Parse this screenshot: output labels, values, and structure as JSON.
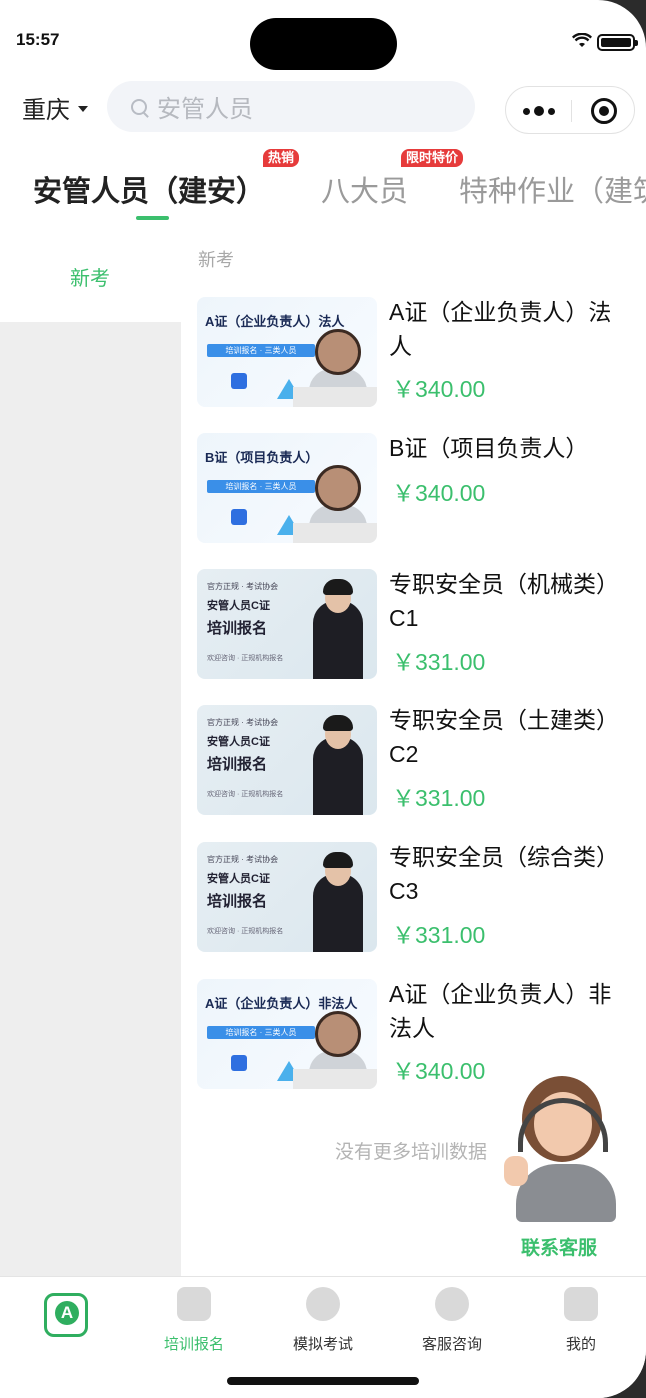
{
  "status": {
    "time": "15:57"
  },
  "header": {
    "city": "重庆",
    "search_placeholder": "安管人员"
  },
  "tabs": [
    {
      "label": "安管人员（建安）",
      "badge": ""
    },
    {
      "label": "八大员",
      "badge": "热销"
    },
    {
      "label": "特种作业（建筑",
      "badge": "限时特价"
    }
  ],
  "categories": [
    {
      "label": "新考"
    }
  ],
  "section_title": "新考",
  "products": [
    {
      "name": "A证（企业负责人）法人",
      "price": "￥340.00",
      "thumb_title": "A证（企业负责人）法人",
      "thumb_sub": "培训报名 · 三类人员"
    },
    {
      "name": "B证（项目负责人）",
      "price": "￥340.00",
      "thumb_title": "B证（项目负责人）",
      "thumb_sub": "培训报名 · 三类人员"
    },
    {
      "name": "专职安全员（机械类）C1",
      "price": "￥331.00",
      "thumb_l1": "官方正规 · 考试协会",
      "thumb_l2": "安管人员C证",
      "thumb_l3": "培训报名",
      "thumb_l4": "欢迎咨询 · 正规机构报名"
    },
    {
      "name": "专职安全员（土建类）C2",
      "price": "￥331.00",
      "thumb_l1": "官方正规 · 考试协会",
      "thumb_l2": "安管人员C证",
      "thumb_l3": "培训报名",
      "thumb_l4": "欢迎咨询 · 正规机构报名"
    },
    {
      "name": "专职安全员（综合类）C3",
      "price": "￥331.00",
      "thumb_l1": "官方正规 · 考试协会",
      "thumb_l2": "安管人员C证",
      "thumb_l3": "培训报名",
      "thumb_l4": "欢迎咨询 · 正规机构报名"
    },
    {
      "name": "A证（企业负责人）非法人",
      "price": "￥340.00",
      "thumb_title": "A证（企业负责人）非法人",
      "thumb_sub": "培训报名 · 三类人员"
    }
  ],
  "no_more": "没有更多培训数据",
  "customer_service": {
    "label": "联系客服"
  },
  "bottom_nav": [
    {
      "label": "",
      "icon": "app-logo-icon"
    },
    {
      "label": "培训报名",
      "icon": "signup-icon"
    },
    {
      "label": "模拟考试",
      "icon": "exam-icon"
    },
    {
      "label": "客服咨询",
      "icon": "service-icon"
    },
    {
      "label": "我的",
      "icon": "profile-icon"
    }
  ],
  "colors": {
    "accent": "#3bbf6d",
    "badge": "#e63b3b"
  }
}
